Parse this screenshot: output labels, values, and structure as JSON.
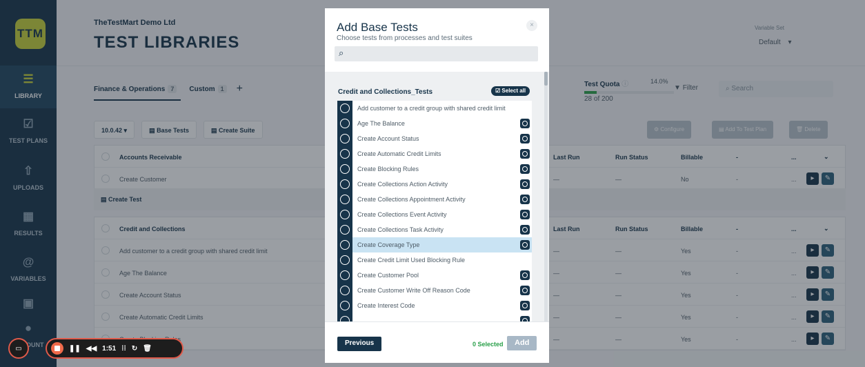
{
  "sidebar": {
    "logo": "TTM",
    "items": [
      {
        "label": "LIBRARY",
        "icon": "library-icon"
      },
      {
        "label": "TEST PLANS",
        "icon": "checklist-icon"
      },
      {
        "label": "UPLOADS",
        "icon": "upload-icon"
      },
      {
        "label": "RESULTS",
        "icon": "results-icon"
      },
      {
        "label": "VARIABLES",
        "icon": "at-icon"
      },
      {
        "label": "",
        "icon": "calendar-icon"
      },
      {
        "label": "ACCOUNT",
        "icon": "user-icon"
      }
    ]
  },
  "header": {
    "org": "TheTestMart Demo Ltd",
    "title": "TEST LIBRARIES",
    "variable_set_label": "Variable Set",
    "variable_set_value": "Default"
  },
  "tabs": [
    {
      "label": "Finance & Operations",
      "count": "7"
    },
    {
      "label": "Custom",
      "count": "1"
    }
  ],
  "quota": {
    "label": "Test Quota",
    "percent": "14.0%",
    "used": "28 of 200",
    "fill_fraction": 0.14
  },
  "filter_label": "Filter",
  "search_placeholder": "Search",
  "toolbar": {
    "version": "10.0.42",
    "base_tests": "Base Tests",
    "create_suite": "Create Suite",
    "configure": "Configure",
    "add_to_plan": "Add To Test Plan",
    "delete": "Delete"
  },
  "table_ar": {
    "header": {
      "name": "Accounts Receivable",
      "last_run": "Last Run",
      "run_status": "Run Status",
      "billable": "Billable",
      "dash": "-",
      "more": "..."
    },
    "rows": [
      {
        "name": "Create Customer",
        "last_run": "—",
        "run_status": "—",
        "billable": "No",
        "dash": "-"
      }
    ]
  },
  "create_test_label": "Create Test",
  "table_cc": {
    "header": {
      "name": "Credit and Collections",
      "last_run": "Last Run",
      "run_status": "Run Status",
      "billable": "Billable",
      "dash": "-",
      "more": "..."
    },
    "rows": [
      {
        "name": "Add customer to a credit group with shared credit limit",
        "last_run": "—",
        "run_status": "—",
        "billable": "Yes",
        "dash": "-"
      },
      {
        "name": "Age The Balance",
        "last_run": "—",
        "run_status": "—",
        "billable": "Yes",
        "dash": "-"
      },
      {
        "name": "Create Account Status",
        "last_run": "—",
        "run_status": "—",
        "billable": "Yes",
        "dash": "-"
      },
      {
        "name": "Create Automatic Credit Limits",
        "last_run": "—",
        "run_status": "—",
        "billable": "Yes",
        "dash": "-"
      },
      {
        "name": "Create Blocking Rules",
        "last_run": "—",
        "run_status": "—",
        "billable": "Yes",
        "dash": "-"
      }
    ]
  },
  "modal": {
    "title": "Add Base Tests",
    "subtitle": "Choose tests from processes and test suites",
    "close": "×",
    "suite_title": "Credit and Collections_Tests",
    "select_all": "Select all",
    "tests": [
      {
        "name": "Add customer to a credit group with shared credit limit",
        "preview": false,
        "highlight": false
      },
      {
        "name": "Age The Balance",
        "preview": true,
        "highlight": false
      },
      {
        "name": "Create Account Status",
        "preview": true,
        "highlight": false
      },
      {
        "name": "Create Automatic Credit Limits",
        "preview": true,
        "highlight": false
      },
      {
        "name": "Create Blocking Rules",
        "preview": true,
        "highlight": false
      },
      {
        "name": "Create Collections Action Activity",
        "preview": true,
        "highlight": false
      },
      {
        "name": "Create Collections Appointment Activity",
        "preview": true,
        "highlight": false
      },
      {
        "name": "Create Collections Event Activity",
        "preview": true,
        "highlight": false
      },
      {
        "name": "Create Collections Task Activity",
        "preview": true,
        "highlight": false
      },
      {
        "name": "Create Coverage Type",
        "preview": true,
        "highlight": true
      },
      {
        "name": "Create Credit Limit Used Blocking Rule",
        "preview": false,
        "highlight": false
      },
      {
        "name": "Create Customer Pool",
        "preview": true,
        "highlight": false
      },
      {
        "name": "Create Customer Write Off Reason Code",
        "preview": true,
        "highlight": false
      },
      {
        "name": "Create Interest Code",
        "preview": true,
        "highlight": false
      },
      {
        "name": "",
        "preview": true,
        "highlight": false
      }
    ],
    "previous": "Previous",
    "selected": "0 Selected",
    "add": "Add"
  },
  "recorder": {
    "time": "1:51"
  }
}
